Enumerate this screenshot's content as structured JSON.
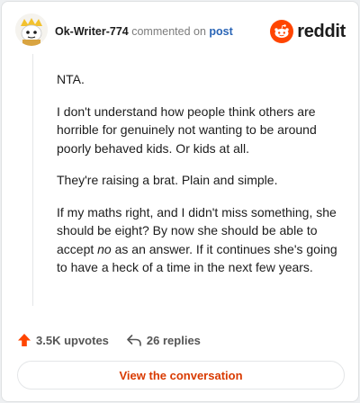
{
  "header": {
    "username": "Ok-Writer-774",
    "action_text": "commented on",
    "post_link": "post",
    "brand": "reddit",
    "avatar_icon": "snoo-avatar-icon",
    "logo_icon": "reddit-snoo-logo-icon",
    "brand_color": "#ff4500"
  },
  "comment": {
    "paragraphs": [
      "NTA.",
      "I don't understand how people think others are horrible for genuinely not wanting to be around poorly behaved kids. Or kids at all.",
      "They're raising a brat. Plain and simple.",
      "If my maths right, and I didn't miss something, she should be eight? By now she should be able to accept ",
      "no",
      " as an answer. If it continues she's going to have a heck of a time in the next few years."
    ]
  },
  "footer": {
    "upvotes": "3.5K upvotes",
    "replies": "26 replies",
    "upvote_icon": "upvote-arrow-icon",
    "reply_icon": "reply-arrow-icon",
    "upvote_color": "#ff4500"
  },
  "cta": {
    "label": "View the conversation",
    "color": "#d93a00"
  }
}
